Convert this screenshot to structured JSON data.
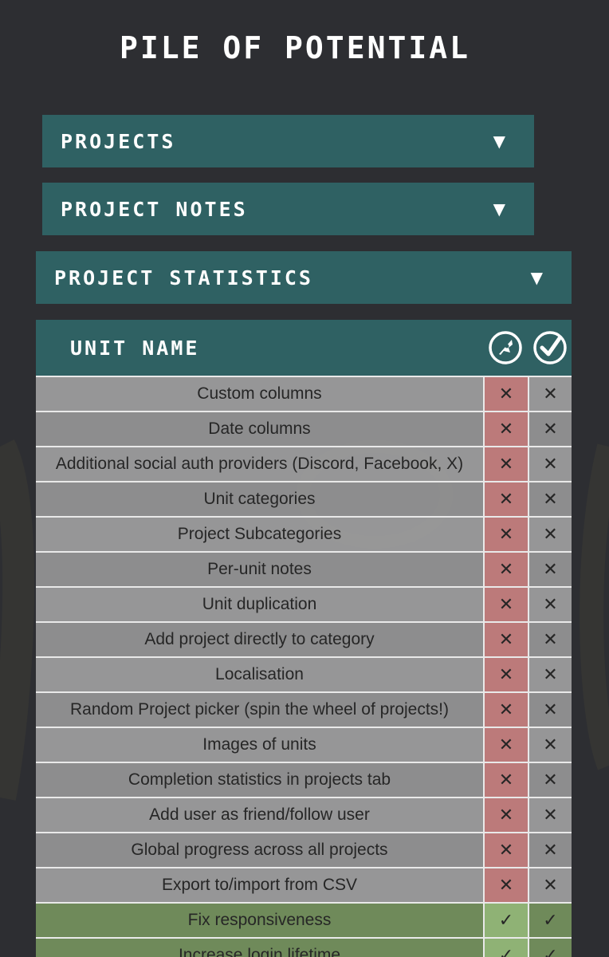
{
  "app": {
    "title": "PILE OF POTENTIAL"
  },
  "sections": {
    "projects": {
      "label": "PROJECTS",
      "chevron": "▼"
    },
    "project_notes": {
      "label": "PROJECT NOTES",
      "chevron": "▼"
    },
    "project_statistics": {
      "label": "PROJECT STATISTICS",
      "chevron": "▼"
    }
  },
  "table": {
    "header": {
      "name": "UNIT NAME",
      "col_a_icon": "rocket-badge-icon",
      "col_b_icon": "check-circle-icon"
    },
    "rows": [
      {
        "name": "Custom columns",
        "a": "✕",
        "b": "✕",
        "status": "todo"
      },
      {
        "name": "Date columns",
        "a": "✕",
        "b": "✕",
        "status": "todo"
      },
      {
        "name": "Additional social auth providers (Discord, Facebook, X)",
        "a": "✕",
        "b": "✕",
        "status": "todo"
      },
      {
        "name": "Unit categories",
        "a": "✕",
        "b": "✕",
        "status": "todo"
      },
      {
        "name": "Project Subcategories",
        "a": "✕",
        "b": "✕",
        "status": "todo"
      },
      {
        "name": "Per-unit notes",
        "a": "✕",
        "b": "✕",
        "status": "todo"
      },
      {
        "name": "Unit duplication",
        "a": "✕",
        "b": "✕",
        "status": "todo"
      },
      {
        "name": "Add project directly to category",
        "a": "✕",
        "b": "✕",
        "status": "todo"
      },
      {
        "name": "Localisation",
        "a": "✕",
        "b": "✕",
        "status": "todo"
      },
      {
        "name": "Random Project picker (spin the wheel of projects!)",
        "a": "✕",
        "b": "✕",
        "status": "todo"
      },
      {
        "name": "Images of units",
        "a": "✕",
        "b": "✕",
        "status": "todo"
      },
      {
        "name": "Completion statistics in projects tab",
        "a": "✕",
        "b": "✕",
        "status": "todo"
      },
      {
        "name": "Add user as friend/follow user",
        "a": "✕",
        "b": "✕",
        "status": "todo"
      },
      {
        "name": "Global progress across all projects",
        "a": "✕",
        "b": "✕",
        "status": "todo"
      },
      {
        "name": "Export to/import from CSV",
        "a": "✕",
        "b": "✕",
        "status": "todo"
      },
      {
        "name": "Fix responsiveness",
        "a": "✓",
        "b": "✓",
        "status": "done"
      },
      {
        "name": "Increase login lifetime",
        "a": "✓",
        "b": "✓",
        "status": "done"
      }
    ]
  },
  "colors": {
    "background": "#2d2e32",
    "accent_teal": "#2f6163",
    "todo_red": "#c47e7e",
    "done_green": "#8fb275"
  }
}
